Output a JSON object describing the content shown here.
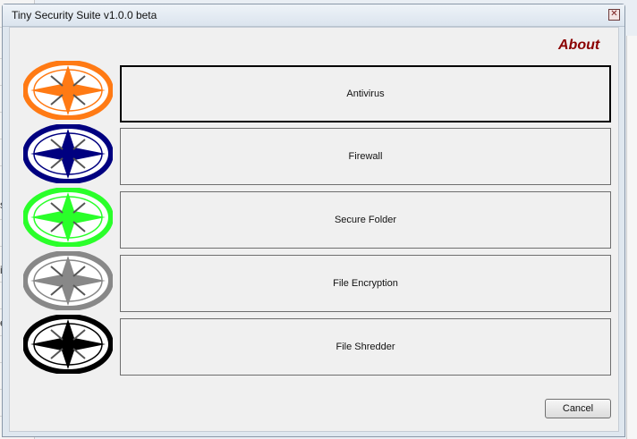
{
  "window": {
    "title": "Tiny Security Suite v1.0.0 beta",
    "close_glyph": "✕"
  },
  "about_link": "About",
  "features": [
    {
      "label": "Antivirus",
      "icon": "compass-icon-orange",
      "color": "#ff7a14"
    },
    {
      "label": "Firewall",
      "icon": "compass-icon-navy",
      "color": "#000080"
    },
    {
      "label": "Secure Folder",
      "icon": "compass-icon-green",
      "color": "#2aff2a"
    },
    {
      "label": "File Encryption",
      "icon": "compass-icon-gray",
      "color": "#888888"
    },
    {
      "label": "File Shredder",
      "icon": "compass-icon-black",
      "color": "#000000"
    }
  ],
  "cancel_label": "Cancel",
  "background_fragments": [
    "s",
    "in",
    "e"
  ]
}
